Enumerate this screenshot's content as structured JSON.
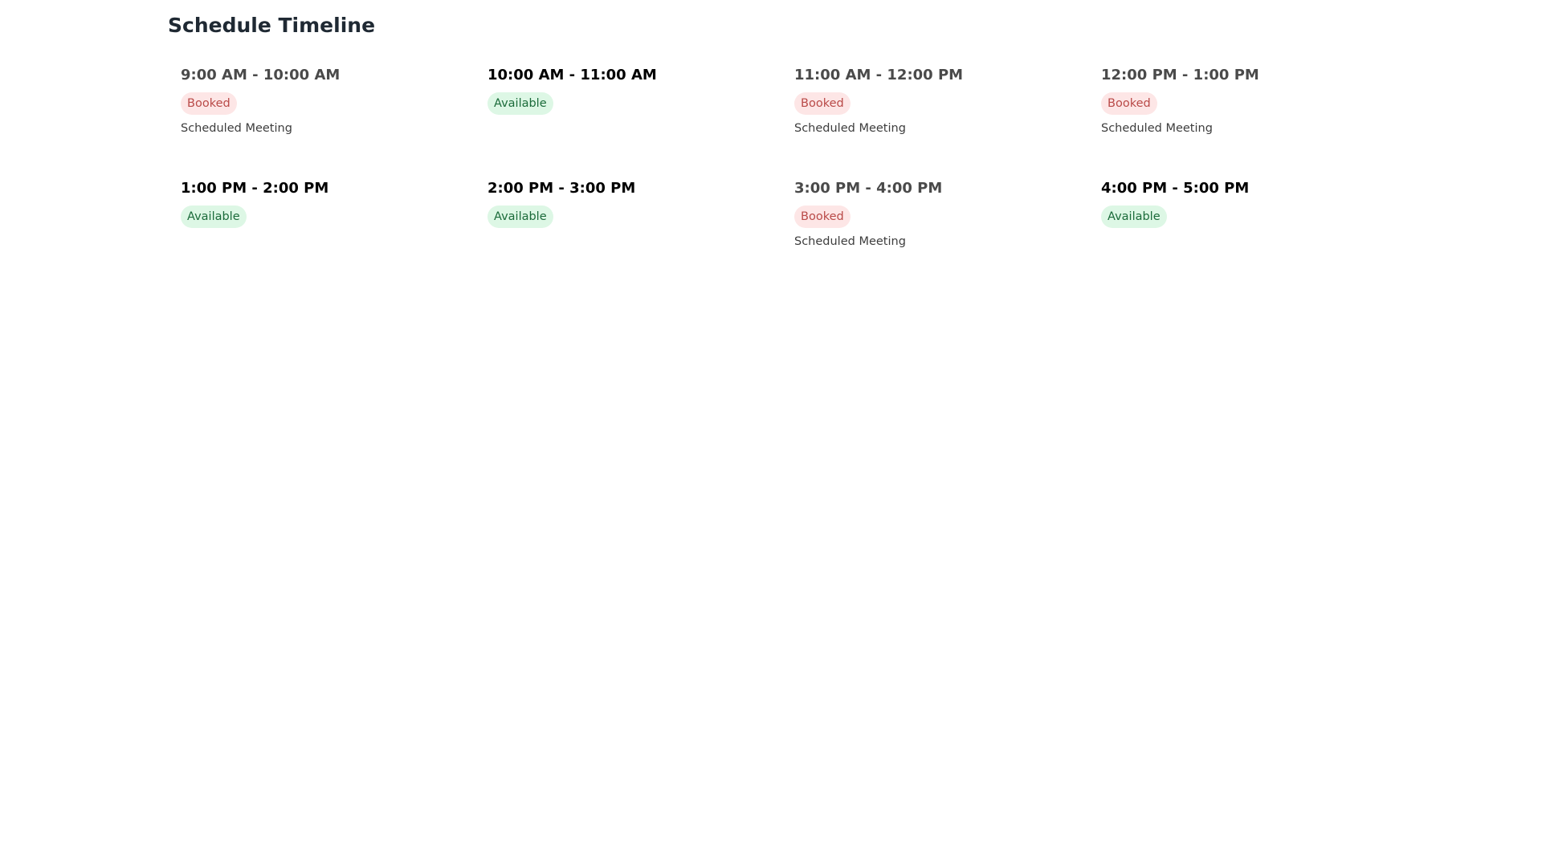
{
  "page": {
    "title": "Schedule Timeline"
  },
  "colors": {
    "booked_bg": "#fde6e6",
    "booked_text": "#b94a48",
    "available_bg": "#ddf7e5",
    "available_text": "#1b6b3a",
    "title_text": "#1f2933"
  },
  "slots": [
    {
      "time": "9:00 AM - 10:00 AM",
      "status": "Booked",
      "note": "Scheduled Meeting"
    },
    {
      "time": "10:00 AM - 11:00 AM",
      "status": "Available",
      "note": ""
    },
    {
      "time": "11:00 AM - 12:00 PM",
      "status": "Booked",
      "note": "Scheduled Meeting"
    },
    {
      "time": "12:00 PM - 1:00 PM",
      "status": "Booked",
      "note": "Scheduled Meeting"
    },
    {
      "time": "1:00 PM - 2:00 PM",
      "status": "Available",
      "note": ""
    },
    {
      "time": "2:00 PM - 3:00 PM",
      "status": "Available",
      "note": ""
    },
    {
      "time": "3:00 PM - 4:00 PM",
      "status": "Booked",
      "note": "Scheduled Meeting"
    },
    {
      "time": "4:00 PM - 5:00 PM",
      "status": "Available",
      "note": ""
    }
  ]
}
